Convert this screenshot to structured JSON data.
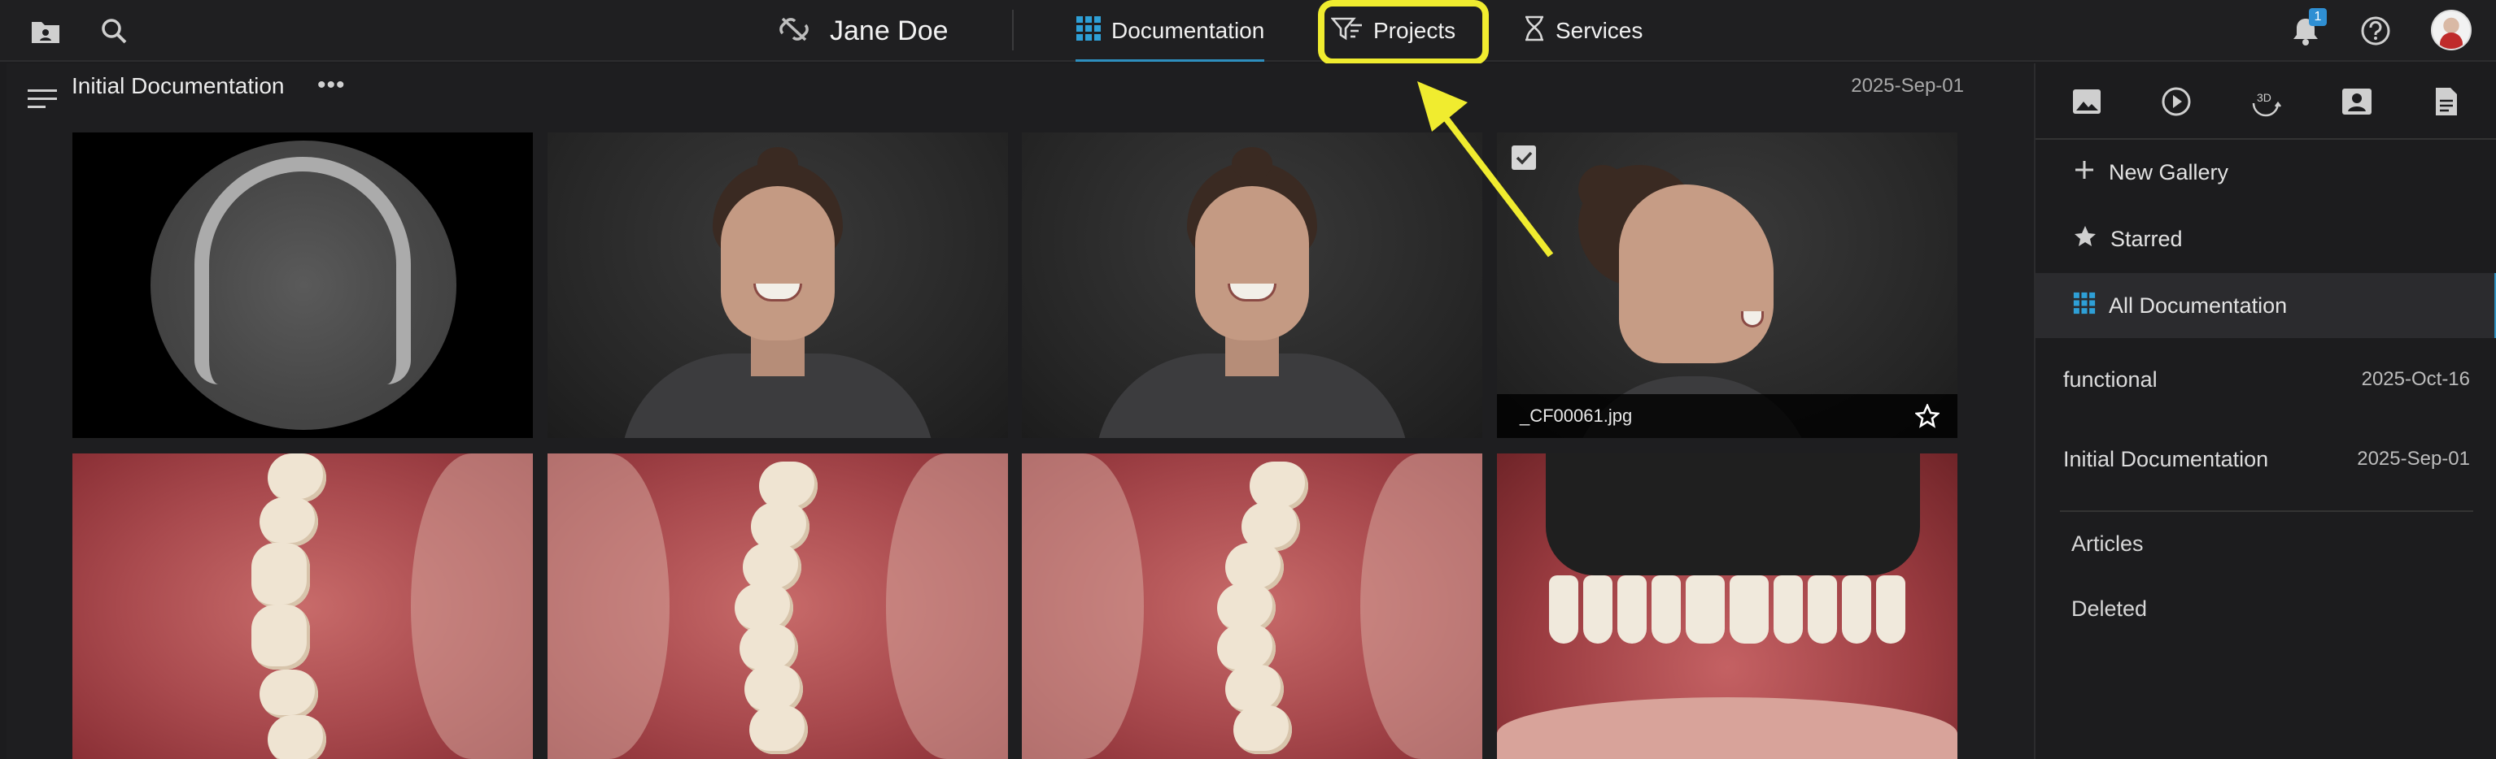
{
  "topbar": {
    "patient_name": "Jane Doe",
    "tabs": [
      {
        "label": "Documentation",
        "icon": "grid-icon"
      },
      {
        "label": "Projects",
        "icon": "projects-filter-icon"
      },
      {
        "label": "Services",
        "icon": "services-icon"
      }
    ],
    "notification_count": "1",
    "active_tab_color": "#2e8fbf",
    "highlight_color": "#f0ec2f"
  },
  "section": {
    "title": "Initial Documentation",
    "date": "2025-Sep-01"
  },
  "thumbnails": [
    {
      "kind": "ct-scan"
    },
    {
      "kind": "portrait-eyes-closed"
    },
    {
      "kind": "portrait-smile"
    },
    {
      "kind": "profile",
      "caption": "_CF00061.jpg"
    },
    {
      "kind": "intraoral-right"
    },
    {
      "kind": "intraoral-occlusal"
    },
    {
      "kind": "intraoral-occlusal-2"
    },
    {
      "kind": "frontal-retracted"
    }
  ],
  "sidebar": {
    "icons": [
      "image-icon",
      "play-icon",
      "3d-icon",
      "portrait-icon",
      "document-icon"
    ],
    "new_gallery": "New Gallery",
    "starred": "Starred",
    "all_documentation": "All Documentation",
    "galleries": [
      {
        "name": "functional",
        "date": "2025-Oct-16"
      },
      {
        "name": "Initial Documentation",
        "date": "2025-Sep-01"
      }
    ],
    "articles": "Articles",
    "deleted": "Deleted"
  }
}
